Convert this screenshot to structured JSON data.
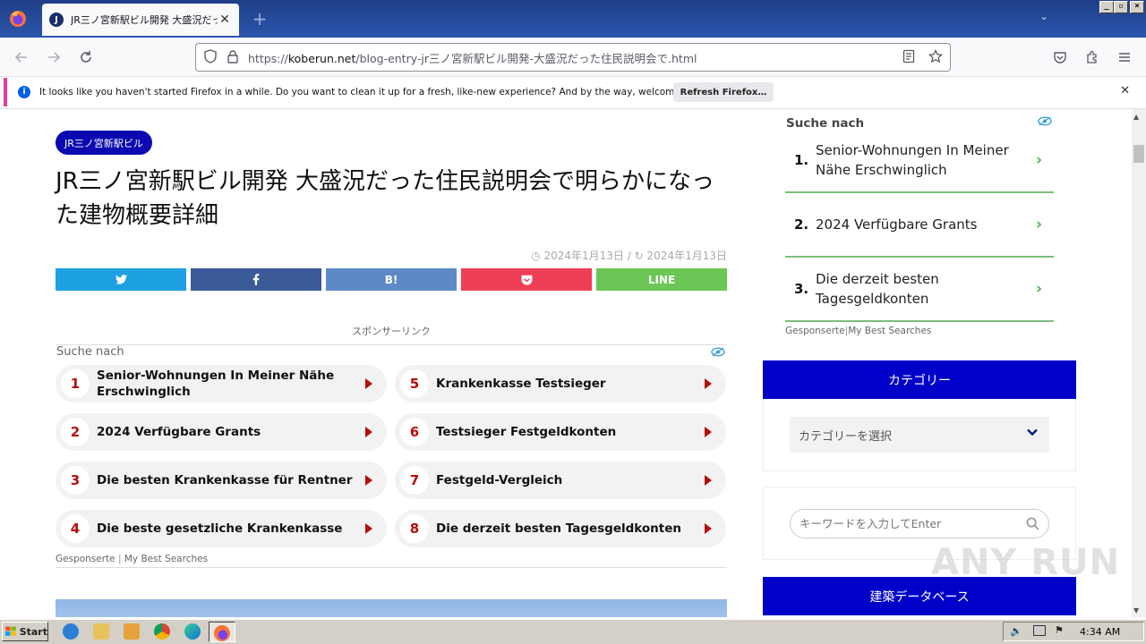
{
  "browser": {
    "tab_title": "JR三ノ宮新駅ビル開発 大盛況だった住民説明会",
    "tab_favicon_letter": "J",
    "url_scheme": "https://",
    "url_host": "koberun.net",
    "url_path": "/blog-entry-jr三ノ宮新駅ビル開発-大盛況だった住民説明会で.html",
    "notification_text": "It looks like you haven't started Firefox in a while. Do you want to clean it up for a fresh, like-new experience? And by the way, welcome back!",
    "notification_button": "Refresh Firefox…"
  },
  "article": {
    "category_badge": "JR三ノ宮新駅ビル",
    "title": "JR三ノ宮新駅ビル開発 大盛況だった住民説明会で明らかになった建物概要詳細",
    "published_date": "2024年1月13日",
    "updated_date": "2024年1月13日",
    "date_separator": "/",
    "share_buttons": [
      {
        "label": "",
        "icon": "twitter-icon",
        "color": "#1da1e2"
      },
      {
        "label": "",
        "icon": "facebook-icon",
        "color": "#3b5b98"
      },
      {
        "label": "B!",
        "icon": "hatena-icon",
        "color": "#5d8ac7"
      },
      {
        "label": "",
        "icon": "pocket-icon",
        "color": "#ef3f56"
      },
      {
        "label": "LINE",
        "icon": "line-icon",
        "color": "#6cc655"
      }
    ],
    "sponsor_label": "スポンサーリンク"
  },
  "ad_main": {
    "search_label": "Suche nach",
    "items": [
      {
        "num": "1",
        "label": "Senior-Wohnungen In Meiner Nähe Erschwinglich"
      },
      {
        "num": "2",
        "label": "2024 Verfügbare Grants"
      },
      {
        "num": "3",
        "label": "Die besten Krankenkasse für Rentner"
      },
      {
        "num": "4",
        "label": "Die beste gesetzliche Krankenkasse"
      },
      {
        "num": "5",
        "label": "Krankenkasse Testsieger"
      },
      {
        "num": "6",
        "label": "Testsieger Festgeldkonten"
      },
      {
        "num": "7",
        "label": "Festgeld-Vergleich"
      },
      {
        "num": "8",
        "label": "Die derzeit besten Tagesgeldkonten"
      }
    ],
    "footer_a": "Gesponserte",
    "footer_b": "My Best Searches"
  },
  "sidebar": {
    "search_label": "Suche nach",
    "items": [
      {
        "num": "1.",
        "label": "Senior-Wohnungen In Meiner Nähe Erschwinglich"
      },
      {
        "num": "2.",
        "label": "2024 Verfügbare Grants"
      },
      {
        "num": "3.",
        "label": "Die derzeit besten Tagesgeldkonten"
      }
    ],
    "footer_a": "Gesponserte",
    "footer_b": "My Best Searches",
    "category_heading": "カテゴリー",
    "category_select": "カテゴリーを選択",
    "search_placeholder": "キーワードを入力してEnter",
    "database_heading": "建築データベース"
  },
  "watermark": "ANY RUN",
  "taskbar": {
    "start_label": "Start",
    "clock": "4:34 AM"
  }
}
